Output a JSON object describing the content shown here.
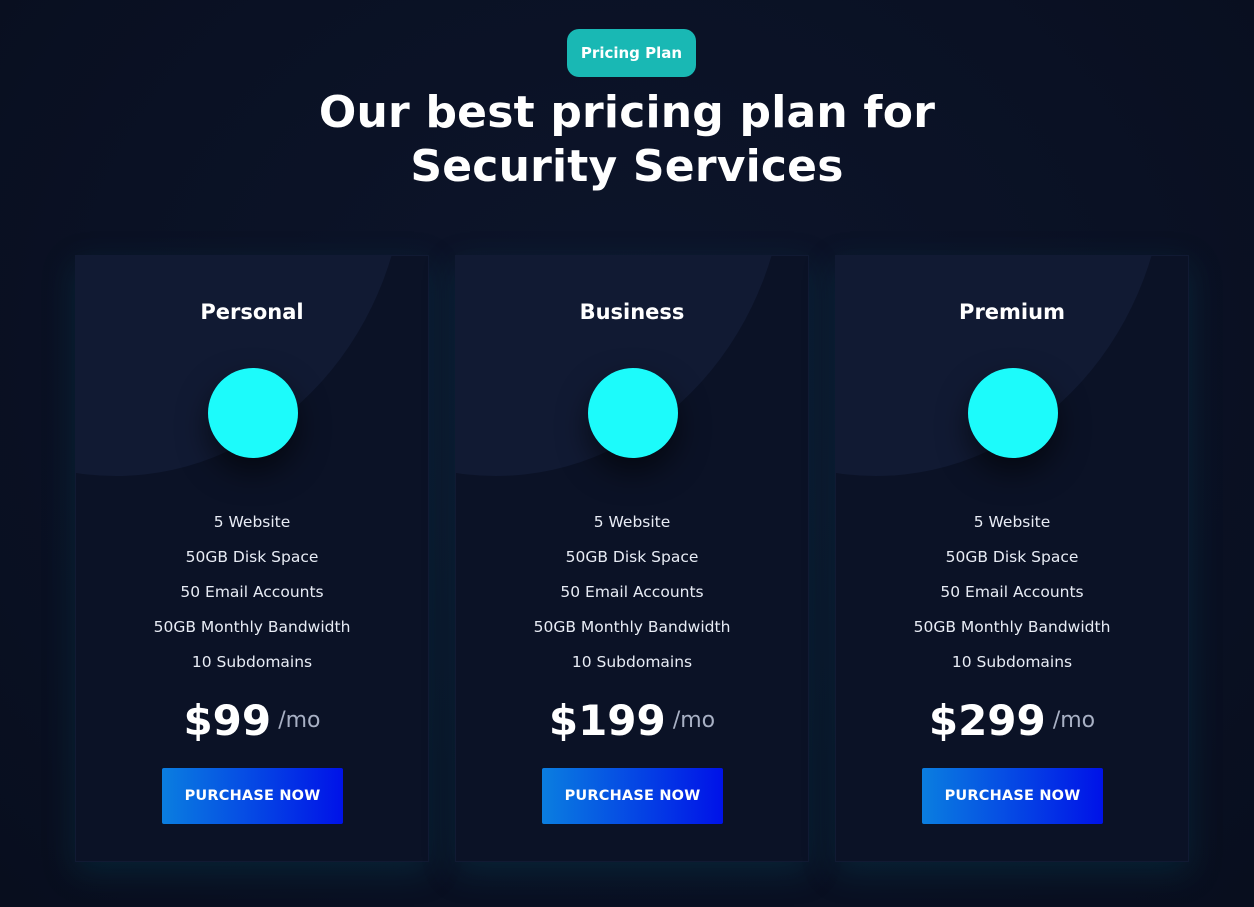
{
  "header": {
    "badge": "Pricing Plan",
    "title_line1": "Our best pricing plan for",
    "title_line2": "Security Services"
  },
  "colors": {
    "background": "#0a1124",
    "card": "#0b1226",
    "badge": "#19b8b4",
    "icon": "#1cfbfb",
    "button_start": "#0a7ee0",
    "button_end": "#0012e8"
  },
  "plans": [
    {
      "name": "Personal",
      "icon": "circle-icon",
      "features": [
        "5 Website",
        "50GB Disk Space",
        "50 Email Accounts",
        "50GB Monthly Bandwidth",
        "10 Subdomains"
      ],
      "price": "$99",
      "period": "/mo",
      "button": "PURCHASE NOW"
    },
    {
      "name": "Business",
      "icon": "circle-icon",
      "features": [
        "5 Website",
        "50GB Disk Space",
        "50 Email Accounts",
        "50GB Monthly Bandwidth",
        "10 Subdomains"
      ],
      "price": "$199",
      "period": "/mo",
      "button": "PURCHASE NOW"
    },
    {
      "name": "Premium",
      "icon": "circle-icon",
      "features": [
        "5 Website",
        "50GB Disk Space",
        "50 Email Accounts",
        "50GB Monthly Bandwidth",
        "10 Subdomains"
      ],
      "price": "$299",
      "period": "/mo",
      "button": "PURCHASE NOW"
    }
  ]
}
